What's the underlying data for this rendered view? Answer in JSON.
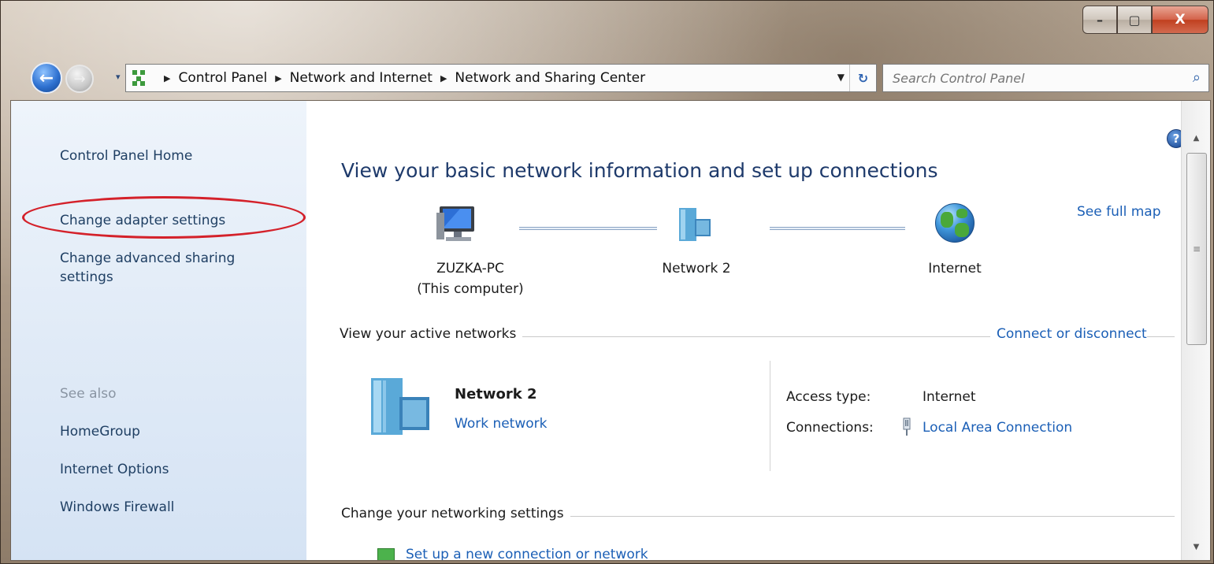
{
  "window": {
    "minimize_label": "–",
    "maximize_label": "▢",
    "close_label": "X"
  },
  "nav": {
    "back_icon": "←",
    "forward_icon": "→",
    "recent_icon": "▾"
  },
  "address": {
    "crumbs": [
      "Control Panel",
      "Network and Internet",
      "Network and Sharing Center"
    ],
    "separator": "▶",
    "dropdown_icon": "▼",
    "refresh_icon": "↻"
  },
  "search": {
    "placeholder": "Search Control Panel",
    "icon": "⌕"
  },
  "sidebar": {
    "home": "Control Panel Home",
    "adapter": "Change adapter settings",
    "sharing_line1": "Change advanced sharing",
    "sharing_line2": "settings",
    "see_also": "See also",
    "links": [
      "HomeGroup",
      "Internet Options",
      "Windows Firewall"
    ]
  },
  "main": {
    "help_icon": "?",
    "heading": "View your basic network information and set up connections",
    "see_full_map": "See full map",
    "map": {
      "computer_name": "ZUZKA-PC",
      "computer_sub": "(This computer)",
      "network": "Network  2",
      "internet": "Internet"
    },
    "active_title": "View your active networks",
    "connect_link": "Connect or disconnect",
    "network_name": "Network  2",
    "network_type": "Work network",
    "access_label": "Access type:",
    "access_value": "Internet",
    "connections_label": "Connections:",
    "connections_value": "Local Area Connection",
    "change_title": "Change your networking settings",
    "partial_link": "Set up a new connection or network"
  },
  "scroll": {
    "up": "▲",
    "down": "▼",
    "grip": "≡"
  }
}
